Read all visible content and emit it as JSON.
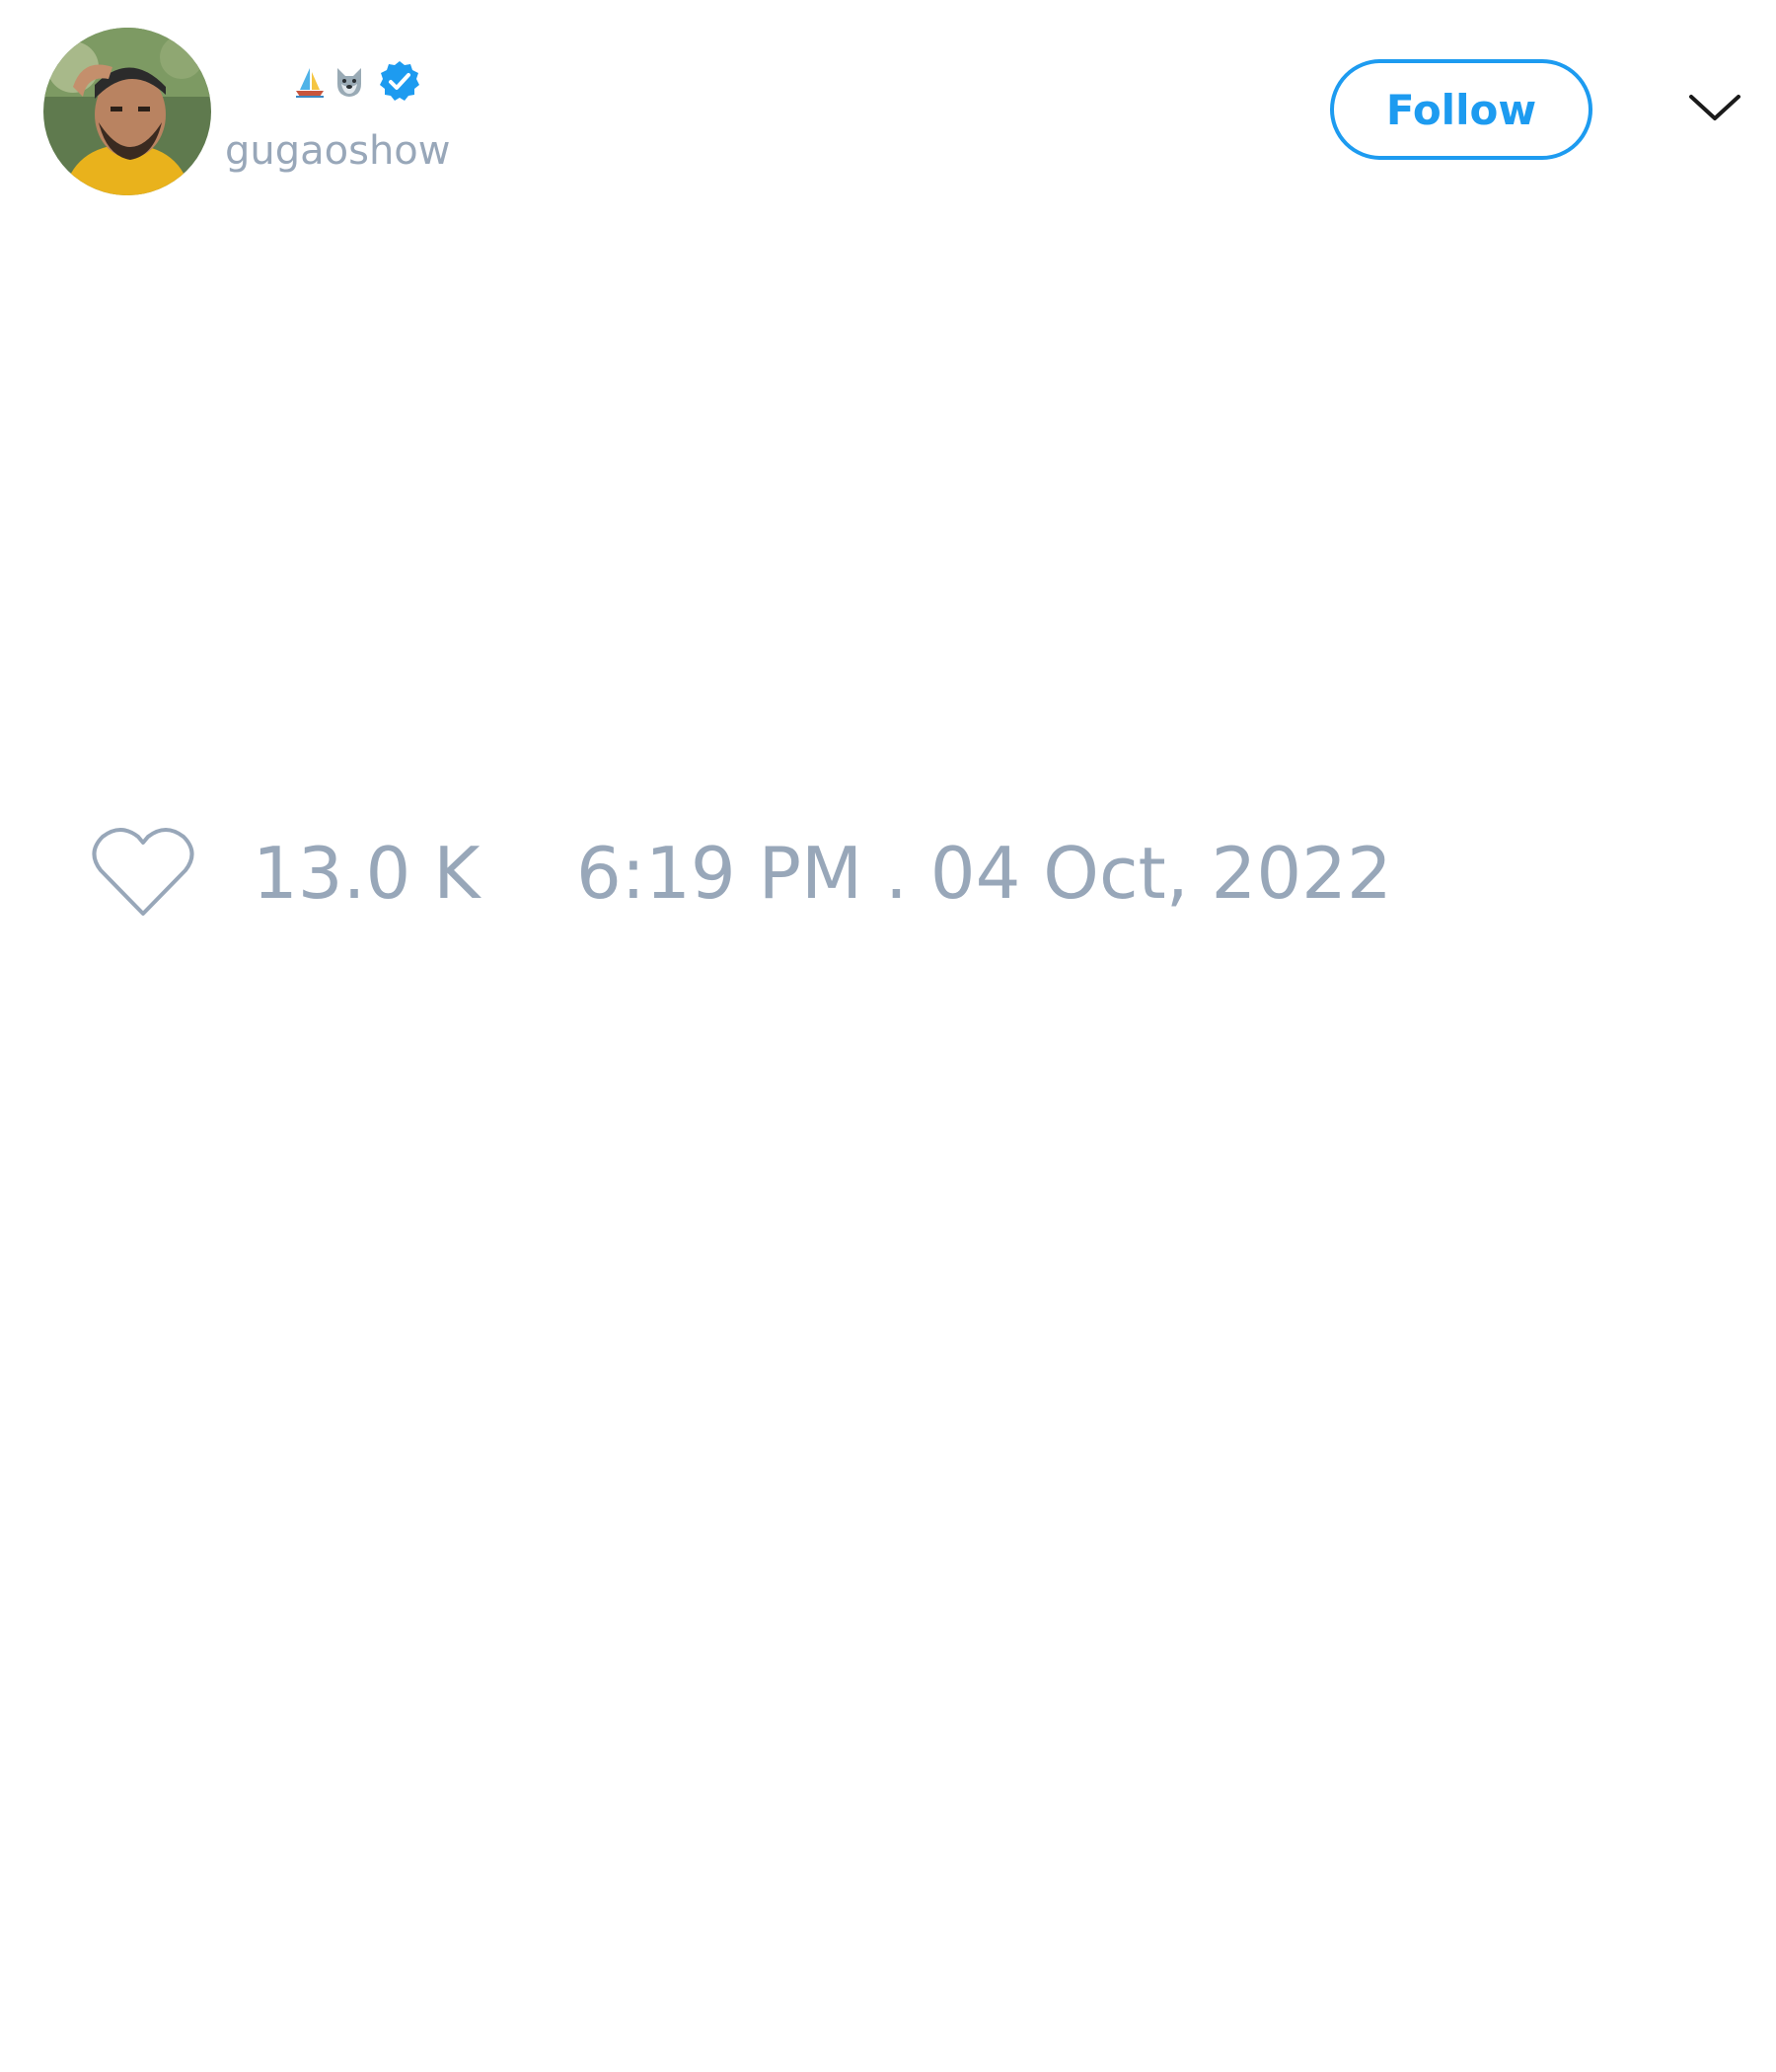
{
  "author": {
    "display_name_emojis": [
      "sailboat-emoji",
      "wolf-emoji"
    ],
    "verified": true,
    "handle": "gugaoshow",
    "avatar": "profile-photo"
  },
  "header": {
    "follow_label": "Follow",
    "menu_icon": "chevron-down-icon"
  },
  "stats": {
    "like_icon": "heart-outline-icon",
    "like_count": "13.0 K",
    "timestamp": "6:19 PM . 04 Oct, 2022"
  },
  "colors": {
    "accent": "#1d9bf0",
    "muted_text": "#98a7b9",
    "background": "#ffffff"
  }
}
